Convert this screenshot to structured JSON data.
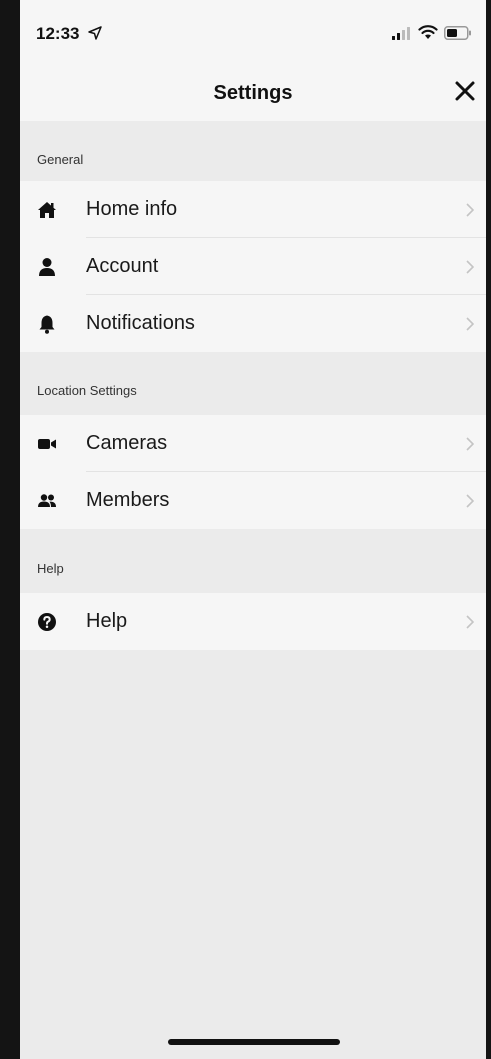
{
  "status_bar": {
    "time": "12:33"
  },
  "header": {
    "title": "Settings"
  },
  "sections": [
    {
      "header": "General",
      "items": [
        {
          "label": "Home info",
          "icon": "home-icon"
        },
        {
          "label": "Account",
          "icon": "person-icon"
        },
        {
          "label": "Notifications",
          "icon": "bell-icon"
        }
      ]
    },
    {
      "header": "Location Settings",
      "items": [
        {
          "label": "Cameras",
          "icon": "video-camera-icon"
        },
        {
          "label": "Members",
          "icon": "users-icon"
        }
      ]
    },
    {
      "header": "Help",
      "items": [
        {
          "label": "Help",
          "icon": "question-circle-icon"
        }
      ]
    }
  ],
  "colors": {
    "background": "#ebebeb",
    "row_background": "#f6f6f6",
    "text": "#1a1a1a",
    "chevron": "#c4c4c4"
  }
}
